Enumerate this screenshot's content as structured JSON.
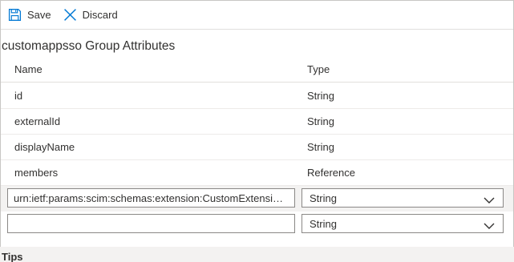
{
  "toolbar": {
    "save_label": "Save",
    "discard_label": "Discard"
  },
  "title": "customappsso Group Attributes",
  "table": {
    "columns": [
      "Name",
      "Type"
    ],
    "rows": [
      {
        "name": "id",
        "type": "String"
      },
      {
        "name": "externalId",
        "type": "String"
      },
      {
        "name": "displayName",
        "type": "String"
      },
      {
        "name": "members",
        "type": "Reference"
      }
    ]
  },
  "edit_rows": [
    {
      "name_value": "urn:ietf:params:scim:schemas:extension:CustomExtension...",
      "type_value": "String"
    },
    {
      "name_value": "",
      "type_value": "String"
    }
  ],
  "tips_label": "Tips",
  "colors": {
    "accent": "#0078d4",
    "text": "#323130",
    "border": "#8a8886",
    "selected_row": "#f3f2f1"
  },
  "icons": {
    "save": "save-icon",
    "discard": "close-icon",
    "dropdown": "chevron-down-icon"
  }
}
